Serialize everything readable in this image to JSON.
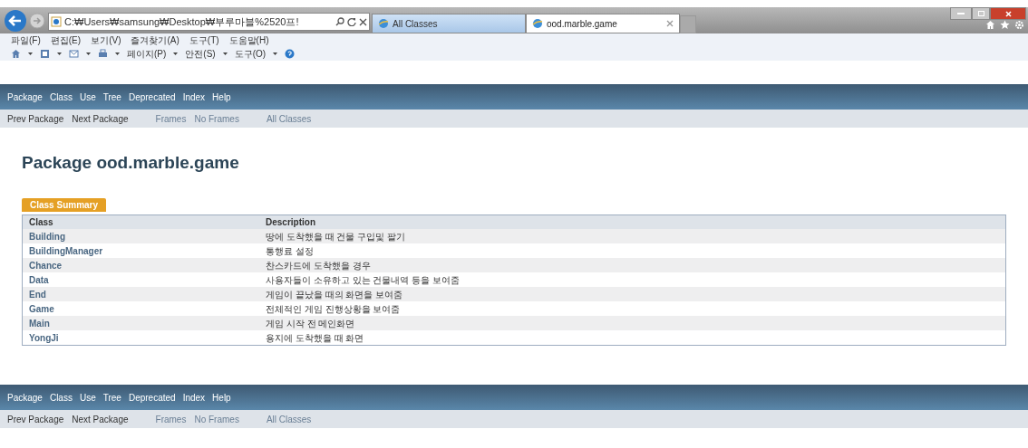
{
  "browser": {
    "address": "C:₩Users₩samsung₩Desktop₩부루마블%2520프!",
    "tabs": [
      {
        "label": "All Classes",
        "selected": false
      },
      {
        "label": "ood.marble.game",
        "selected": true
      }
    ],
    "menu": [
      "파일(F)",
      "편집(E)",
      "보기(V)",
      "즐겨찾기(A)",
      "도구(T)",
      "도움말(H)"
    ],
    "command_bar": [
      "페이지(P)",
      "안전(S)",
      "도구(O)"
    ]
  },
  "top_nav": {
    "items": [
      "Package",
      "Class",
      "Use",
      "Tree",
      "Deprecated",
      "Index",
      "Help"
    ],
    "sub_items": [
      "Prev Package",
      "Next Package",
      "Frames",
      "No Frames",
      "All Classes"
    ]
  },
  "heading": "Package ood.marble.game",
  "summary_tab": "Class Summary",
  "table": {
    "columns": [
      "Class",
      "Description"
    ],
    "rows": [
      [
        "Building",
        "땅에 도착했을 때 건물 구입및 팔기"
      ],
      [
        "BuildingManager",
        "통행료 설정"
      ],
      [
        "Chance",
        "찬스카드에 도착했을 경우"
      ],
      [
        "Data",
        "사용자들이 소유하고 있는 건물내역 등을 보여줌"
      ],
      [
        "End",
        "게임이 끝났을 때의 화면을 보여줌"
      ],
      [
        "Game",
        "전체적인 게임 진행상황을 보여줌"
      ],
      [
        "Main",
        "게임 시작 전 메인화면"
      ],
      [
        "YongJi",
        "용지에 도착했을 때 화면"
      ]
    ]
  },
  "bottom_nav": {
    "items": [
      "Package",
      "Class",
      "Use",
      "Tree",
      "Deprecated",
      "Index",
      "Help"
    ],
    "sub_items": [
      "Prev Package",
      "Next Package",
      "Frames",
      "No Frames",
      "All Classes"
    ]
  }
}
